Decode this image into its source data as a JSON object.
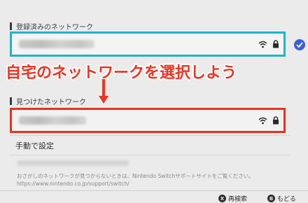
{
  "registered": {
    "section_label": "登録済みのネットワーク"
  },
  "annotation": {
    "text": "自宅のネットワークを選択しよう",
    "color": "#ee3322"
  },
  "found": {
    "section_label": "見つけたネットワーク"
  },
  "manual": {
    "label": "手動で設定"
  },
  "note": {
    "line1": "おさがしのネットワークが見つからないときは、Nintendo Switchサポートサイトをご覧ください。",
    "line2": "https://www.nintendo.co.jp/support/switch/"
  },
  "footer": {
    "rescan_key": "X",
    "rescan_label": "再検索",
    "back_key": "B",
    "back_label": "もどる"
  },
  "colors": {
    "highlight_cyan": "#1fb5c4",
    "highlight_red": "#e8321f",
    "check_blue": "#3c5fd8"
  },
  "icons": [
    "wifi-icon",
    "lock-icon",
    "check-icon",
    "arrow-down-icon"
  ]
}
